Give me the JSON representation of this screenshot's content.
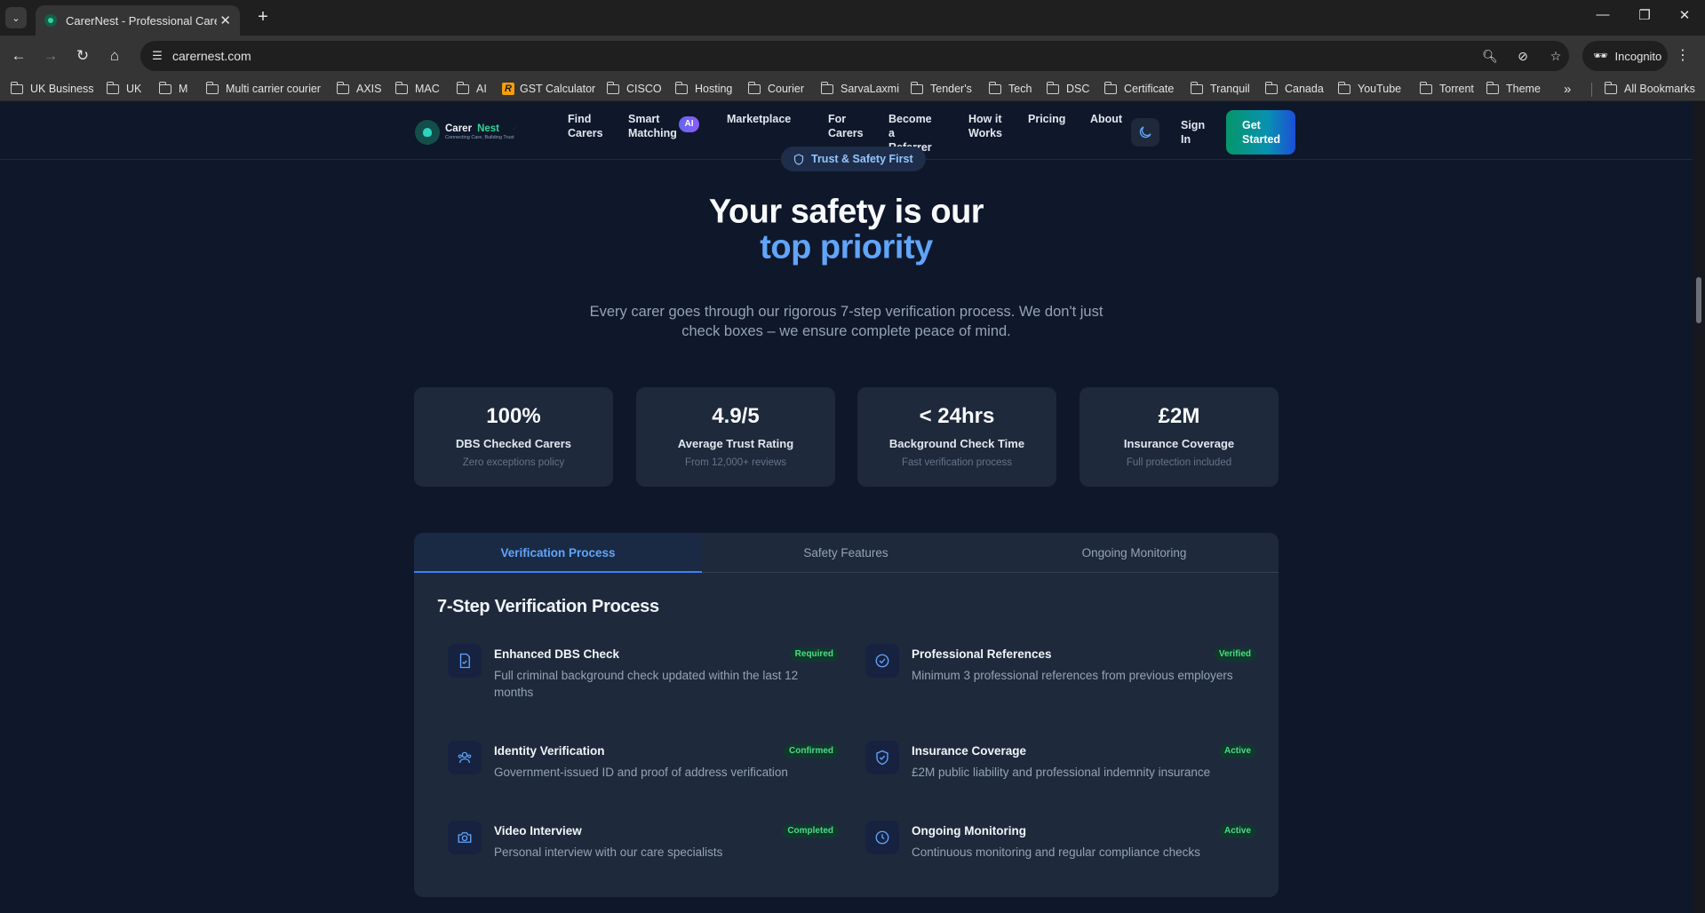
{
  "browser": {
    "tab_title": "CarerNest - Professional Care M",
    "url": "carernest.com",
    "incognito_label": "Incognito",
    "bookmarks": [
      "UK Business",
      "UK",
      "M",
      "Multi carrier courier",
      "AXIS",
      "MAC",
      "AI",
      "GST Calculator",
      "CISCO",
      "Hosting",
      "Courier",
      "SarvaLaxmi",
      "Tender's",
      "Tech",
      "DSC",
      "Certificate",
      "Tranquil",
      "Canada",
      "YouTube",
      "Torrent",
      "Theme"
    ],
    "all_bookmarks": "All Bookmarks",
    "overflow": "»"
  },
  "site": {
    "logo": {
      "carer": "Carer",
      "nest": "Nest",
      "tagline": "Connecting Care, Building Trust"
    },
    "nav": [
      "Find Carers",
      "Smart Matching",
      "Marketplace",
      "For Carers",
      "Become a Referrer",
      "How it Works",
      "Pricing",
      "About"
    ],
    "ai_badge": "AI",
    "sign_in": "Sign In",
    "get_started": "Get Started"
  },
  "hero": {
    "pill": "Trust & Safety First",
    "title_line1": "Your safety is our",
    "title_line2": "top priority",
    "subtitle": "Every carer goes through our rigorous 7-step verification process. We don't just check boxes – we ensure complete peace of mind."
  },
  "stats": [
    {
      "value": "100%",
      "label": "DBS Checked Carers",
      "sub": "Zero exceptions policy"
    },
    {
      "value": "4.9/5",
      "label": "Average Trust Rating",
      "sub": "From 12,000+ reviews"
    },
    {
      "value": "< 24hrs",
      "label": "Background Check Time",
      "sub": "Fast verification process"
    },
    {
      "value": "£2M",
      "label": "Insurance Coverage",
      "sub": "Full protection included"
    }
  ],
  "panel": {
    "tabs": [
      "Verification Process",
      "Safety Features",
      "Ongoing Monitoring"
    ],
    "active_tab": 0,
    "title": "7-Step Verification Process",
    "steps": [
      {
        "icon": "document-check-icon",
        "title": "Enhanced DBS Check",
        "badge": "Required",
        "desc": "Full criminal background check updated within the last 12 months"
      },
      {
        "icon": "check-circle-icon",
        "title": "Professional References",
        "badge": "Verified",
        "desc": "Minimum 3 professional references from previous employers"
      },
      {
        "icon": "users-icon",
        "title": "Identity Verification",
        "badge": "Confirmed",
        "desc": "Government-issued ID and proof of address verification"
      },
      {
        "icon": "shield-check-icon",
        "title": "Insurance Coverage",
        "badge": "Active",
        "desc": "£2M public liability and professional indemnity insurance"
      },
      {
        "icon": "camera-icon",
        "title": "Video Interview",
        "badge": "Completed",
        "desc": "Personal interview with our care specialists"
      },
      {
        "icon": "clock-icon",
        "title": "Ongoing Monitoring",
        "badge": "Active",
        "desc": "Continuous monitoring and regular compliance checks"
      }
    ]
  },
  "colors": {
    "page_bg": "#0f172a",
    "card_bg": "#1e293b",
    "accent_blue": "#60a5fa",
    "badge_green": "#4ade80"
  }
}
